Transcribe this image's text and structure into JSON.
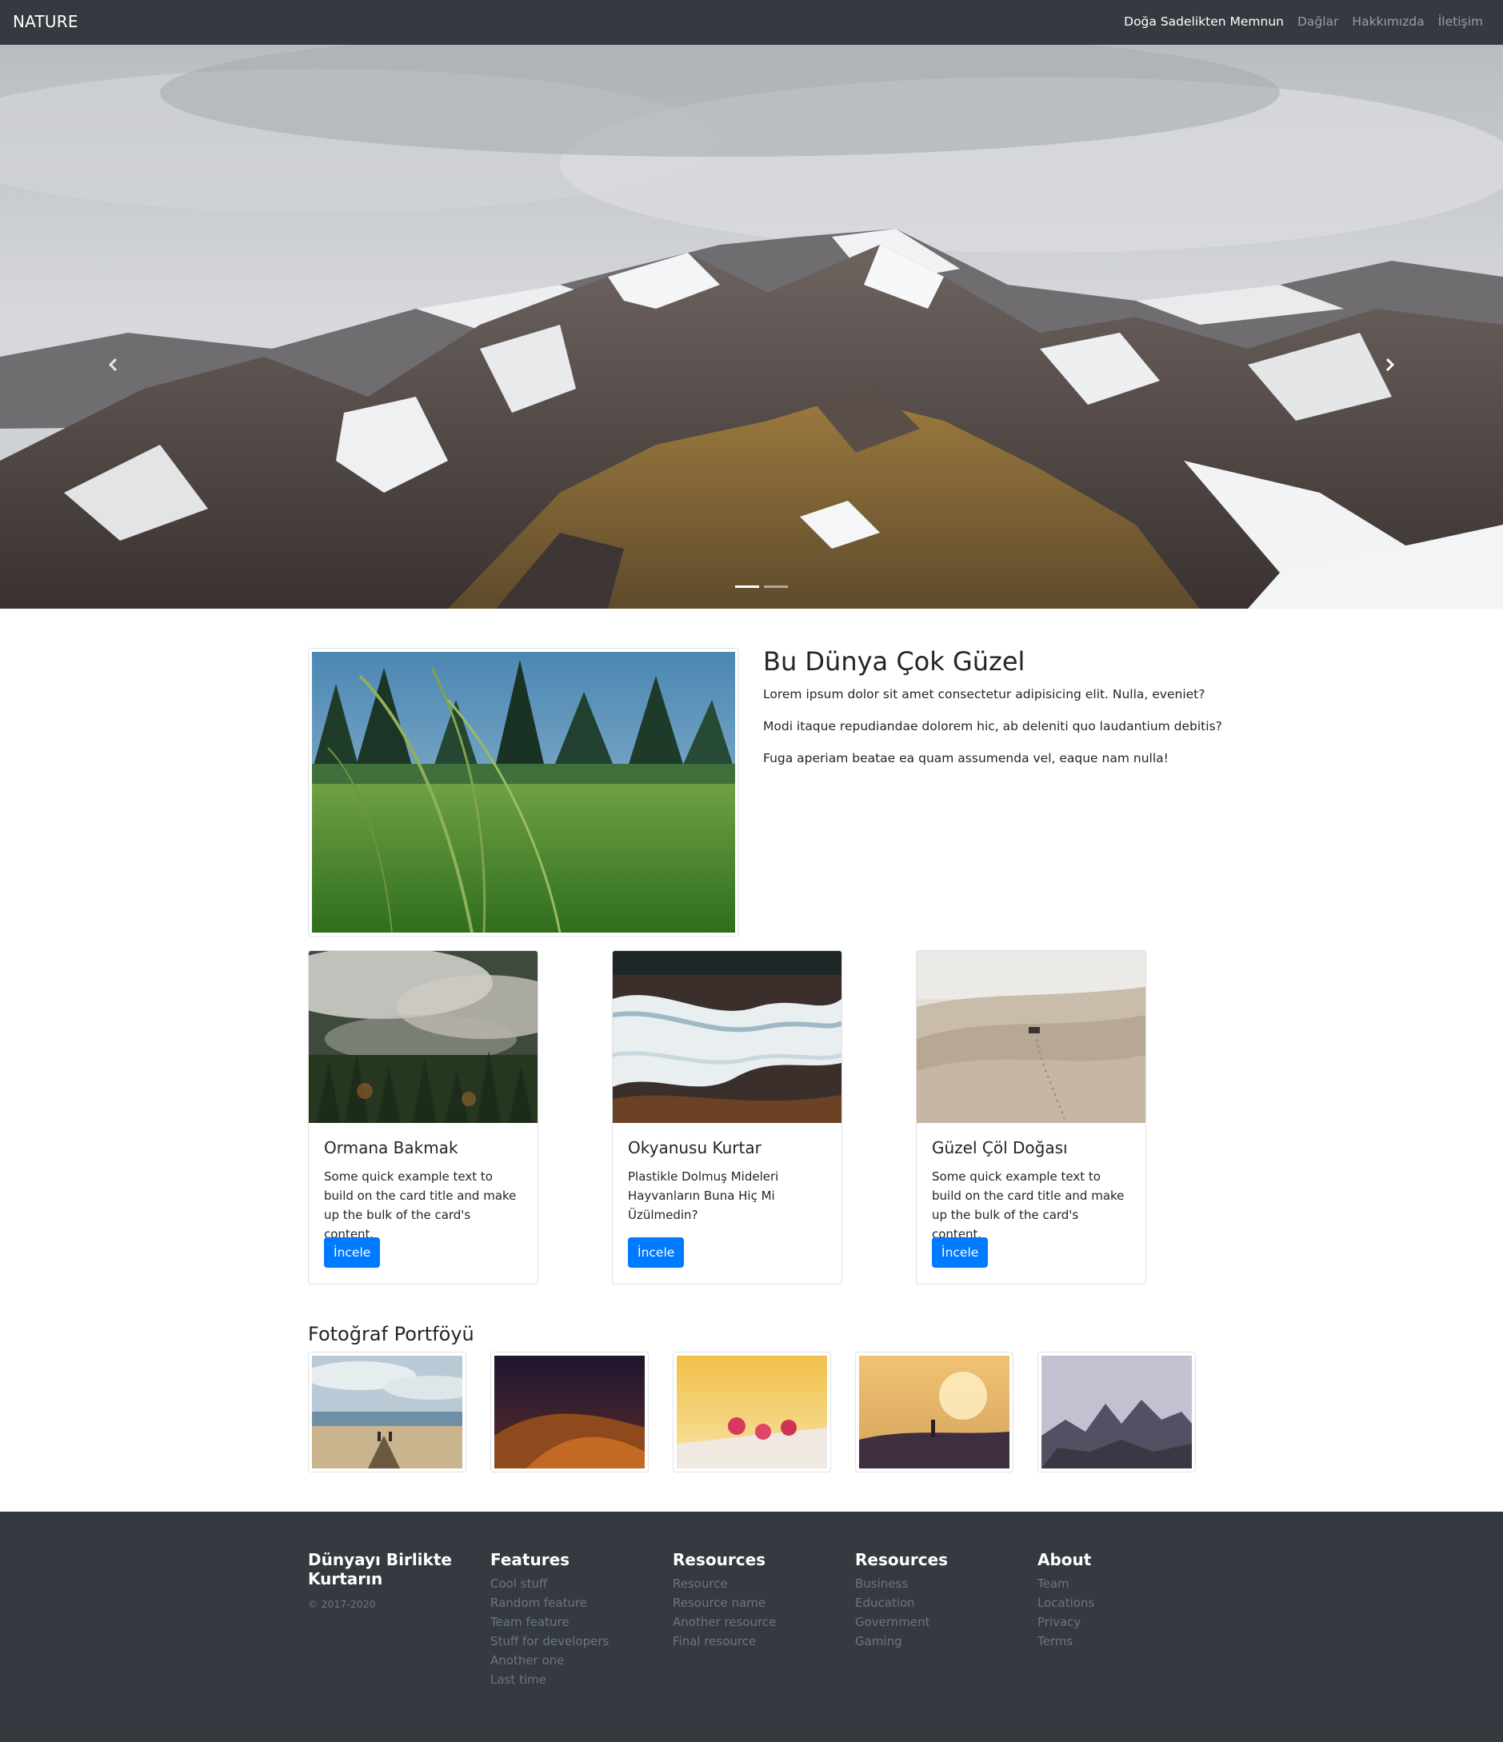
{
  "navbar": {
    "brand": "NATURE",
    "links": [
      "Doğa Sadelikten Memnun",
      "Dağlar",
      "Hakkımızda",
      "İletişim"
    ],
    "active_index": 0
  },
  "carousel": {
    "slide_count": 2,
    "active_index": 0,
    "prev_icon": "chevron-left-icon",
    "next_icon": "chevron-right-icon"
  },
  "feature": {
    "title": "Bu Dünya Çok Güzel",
    "paragraphs": [
      "Lorem ipsum dolor sit amet consectetur adipisicing elit. Nulla, eveniet?",
      "Modi itaque repudiandae dolorem hic, ab deleniti quo laudantium debitis?",
      "Fuga aperiam beatae ea quam assumenda vel, eaque nam nulla!"
    ]
  },
  "cards": [
    {
      "title": "Ormana Bakmak",
      "text": "Some quick example text to build on the card title and make up the bulk of the card's content.",
      "button": "İncele"
    },
    {
      "title": "Okyanusu Kurtar",
      "text": "Plastikle Dolmuş Mideleri Hayvanların Buna Hiç Mi Üzülmedin?",
      "button": "İncele"
    },
    {
      "title": "Güzel Çöl Doğası",
      "text": "Some quick example text to build on the card title and make up the bulk of the card's content.",
      "button": "İncele"
    }
  ],
  "portfolio": {
    "title": "Fotoğraf Portföyü"
  },
  "footer": {
    "brand_line1": "Dünyayı Birlikte",
    "brand_line2": "Kurtarın",
    "copyright": "© 2017-2020",
    "columns": [
      {
        "heading": "Features",
        "items": [
          "Cool stuff",
          "Random feature",
          "Team feature",
          "Stuff for developers",
          "Another one",
          "Last time"
        ]
      },
      {
        "heading": "Resources",
        "items": [
          "Resource",
          "Resource name",
          "Another resource",
          "Final resource"
        ]
      },
      {
        "heading": "Resources",
        "items": [
          "Business",
          "Education",
          "Government",
          "Gaming"
        ]
      },
      {
        "heading": "About",
        "items": [
          "Team",
          "Locations",
          "Privacy",
          "Terms"
        ]
      }
    ]
  },
  "colors": {
    "navbar_bg": "#343a40",
    "footer_bg": "#343a40",
    "primary": "#007bff",
    "muted": "#6c757d"
  }
}
